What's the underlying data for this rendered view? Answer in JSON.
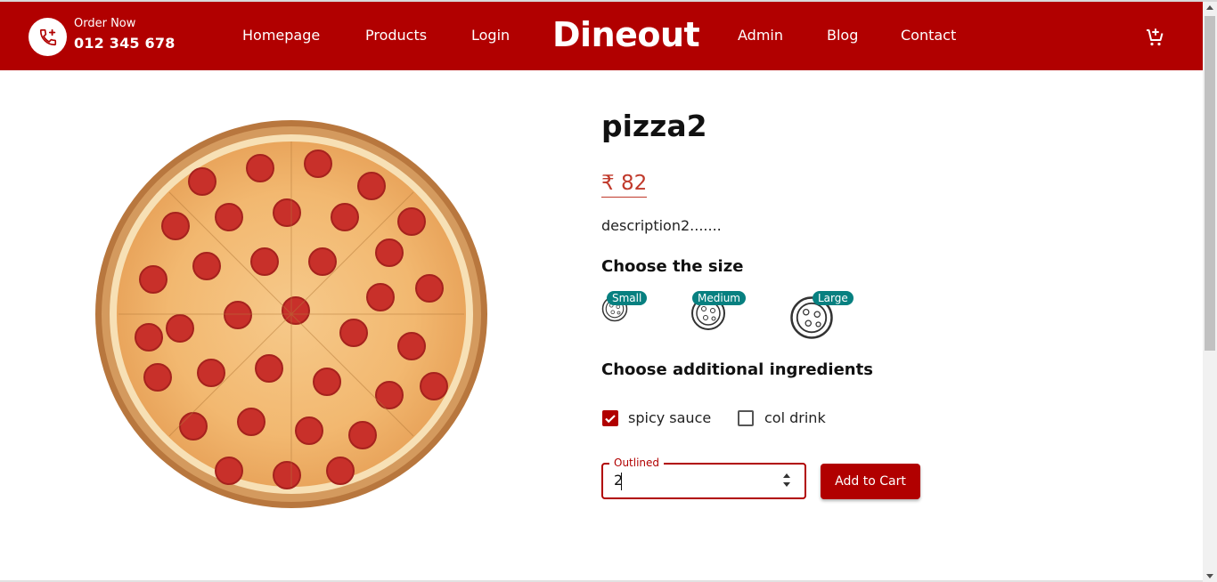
{
  "colors": {
    "brand_red": "#b10000",
    "price_red": "#c0392b",
    "badge_teal": "#078080"
  },
  "header": {
    "order_label": "Order Now",
    "order_number": "012 345 678",
    "phone_icon": "phone-plus-icon",
    "brand": "Dineout",
    "cart_icon": "cart-plus-icon",
    "nav": {
      "homepage": "Homepage",
      "products": "Products",
      "login": "Login",
      "admin": "Admin",
      "blog": "Blog",
      "contact": "Contact"
    }
  },
  "product": {
    "name": "pizza2",
    "price": "₹ 82",
    "description": "description2.......",
    "image_icon": "pepperoni-pizza-image"
  },
  "size_section": {
    "heading": "Choose the size",
    "options": [
      {
        "label": "Small"
      },
      {
        "label": "Medium"
      },
      {
        "label": "Large"
      }
    ]
  },
  "ingredients_section": {
    "heading": "Choose additional ingredients",
    "options": [
      {
        "label": "spicy sauce",
        "checked": true
      },
      {
        "label": "col drink",
        "checked": false
      }
    ]
  },
  "quantity": {
    "label": "Outlined",
    "value": "2"
  },
  "add_to_cart": "Add to Cart"
}
